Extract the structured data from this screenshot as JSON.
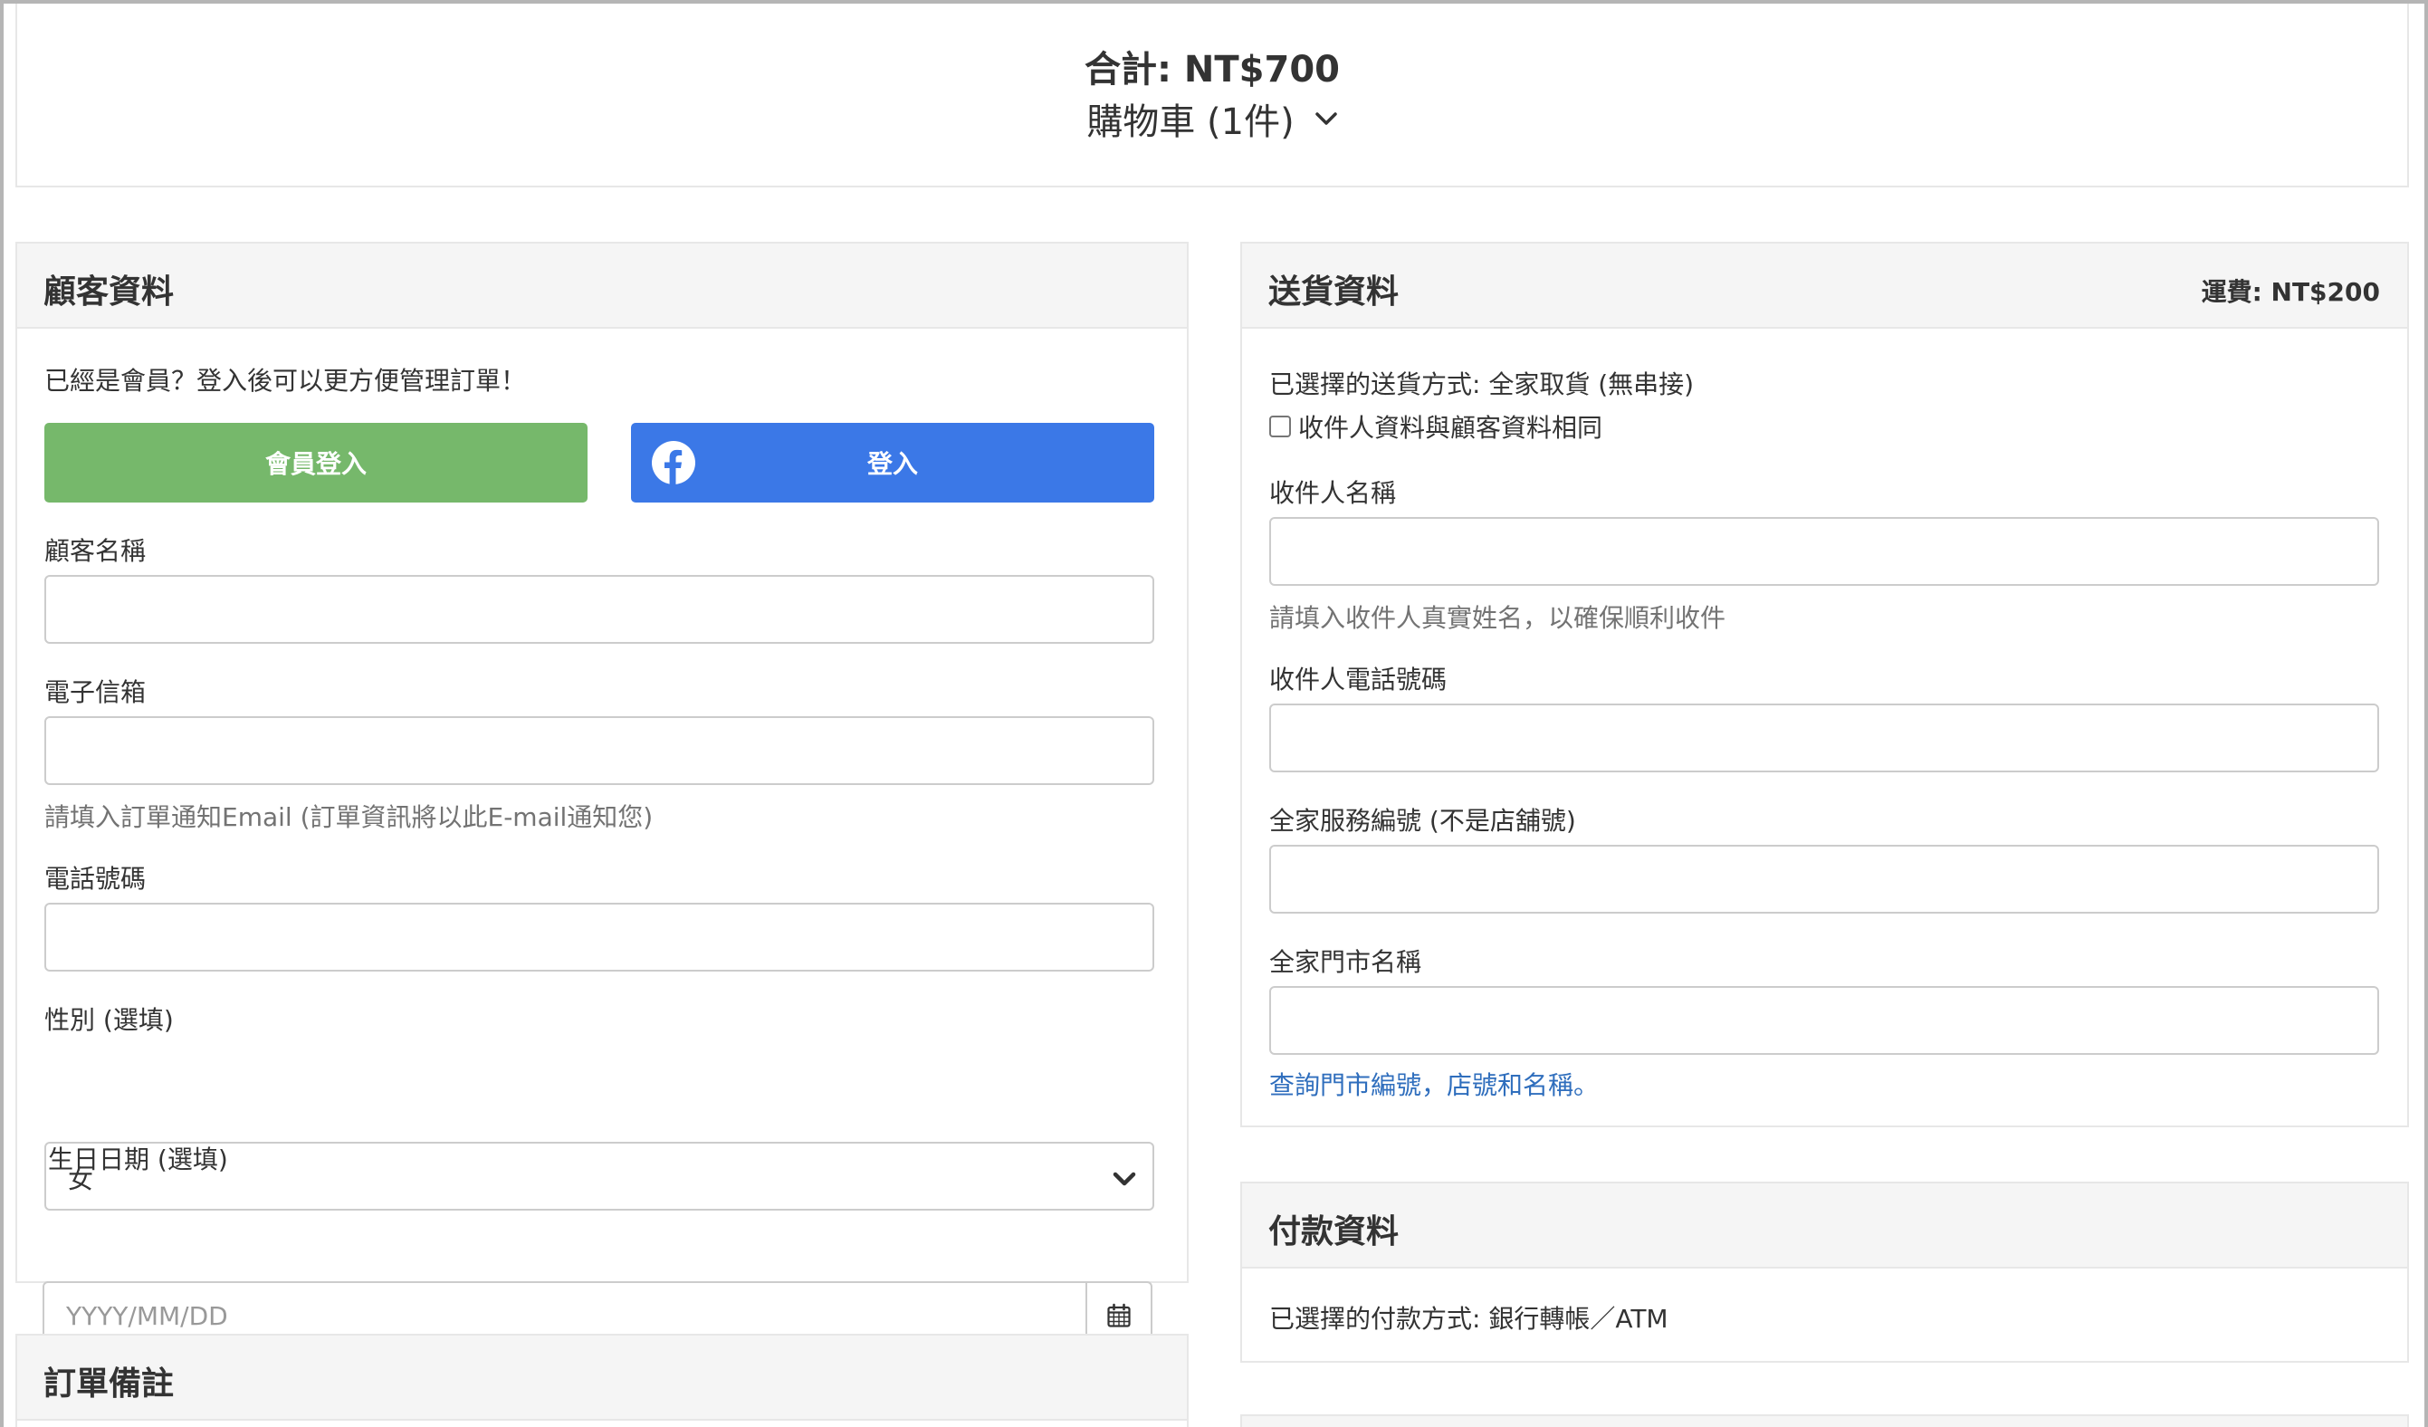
{
  "cart": {
    "total": "合計: NT$700",
    "toggle_label": "購物車 (1件)"
  },
  "customer": {
    "title": "顧客資料",
    "member_prompt": "已經是會員？登入後可以更方便管理訂單！",
    "member_login_button": "會員登入",
    "facebook_login_button": "登入",
    "name_label": "顧客名稱",
    "name_value": "",
    "email_label": "電子信箱",
    "email_value": "",
    "email_help": "請填入訂單通知Email (訂單資訊將以此E-mail通知您)",
    "phone_label": "電話號碼",
    "phone_value": "",
    "gender_label": "性別 (選填)",
    "gender_value": "女",
    "birthday_label": "生日日期 (選填)",
    "birthday_placeholder": "YYYY/MM/DD"
  },
  "order_note": {
    "title": "訂單備註"
  },
  "delivery": {
    "title": "送貨資料",
    "shipping_fee": "運費: NT$200",
    "method_text": "已選擇的送貨方式: 全家取貨 (無串接)",
    "same_as_customer_label": "收件人資料與顧客資料相同",
    "recipient_name_label": "收件人名稱",
    "recipient_name_value": "",
    "recipient_name_help": "請填入收件人真實姓名，以確保順利收件",
    "recipient_phone_label": "收件人電話號碼",
    "recipient_phone_value": "",
    "service_code_label": "全家服務編號 (不是店舖號)",
    "service_code_value": "",
    "store_name_label": "全家門市名稱",
    "store_name_value": "",
    "store_lookup_link": "查詢門市編號，店號和名稱。"
  },
  "payment": {
    "title": "付款資料",
    "method_text": "已選擇的付款方式: 銀行轉帳／ATM"
  },
  "colors": {
    "member_button": "#76b86b",
    "facebook_button": "#3b78e7",
    "link": "#2f6ebd",
    "panel_header_bg": "#f5f5f5",
    "border": "#e7e7e7"
  },
  "icons": {
    "cart_toggle": "chevron-down-icon",
    "facebook": "facebook-icon",
    "select": "chevron-down-icon",
    "calendar": "calendar-icon"
  }
}
